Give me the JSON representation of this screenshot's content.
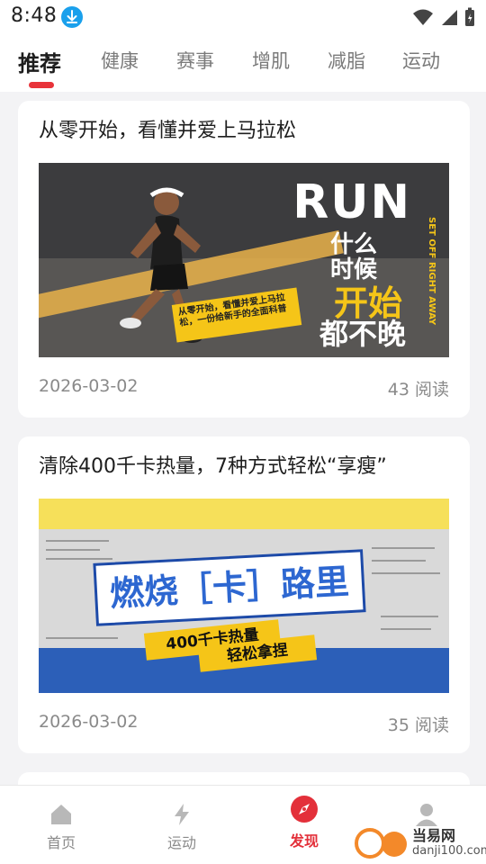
{
  "status_bar": {
    "time": "8:48"
  },
  "tabs": [
    {
      "label": "推荐",
      "active": true
    },
    {
      "label": "健康"
    },
    {
      "label": "赛事"
    },
    {
      "label": "增肌"
    },
    {
      "label": "减脂"
    },
    {
      "label": "运动"
    }
  ],
  "feed": [
    {
      "title": "从零开始，看懂并爱上马拉松",
      "date": "2026-03-02",
      "reads": "43 阅读",
      "banner": {
        "headline": "RUN",
        "line1": "什么",
        "line2": "时候",
        "line3": "开始",
        "line4a": "都",
        "line4b": "不晚",
        "side": "SET OFF RIGHT AWAY",
        "sticker": "从零开始，看懂并爱上马拉松，一份给新手的全面科普"
      }
    },
    {
      "title": "清除400千卡热量，7种方式轻松“享瘦”",
      "date": "2026-03-02",
      "reads": "35 阅读",
      "banner": {
        "headline": "燃烧［卡］路里",
        "tag1": "400千卡热量",
        "tag2": "轻松拿捏"
      }
    }
  ],
  "bottom_nav": [
    {
      "label": "首页",
      "icon": "home-icon"
    },
    {
      "label": "运动",
      "icon": "lightning-icon"
    },
    {
      "label": "发现",
      "icon": "compass-icon",
      "active": true
    },
    {
      "label": "",
      "icon": "profile-icon"
    }
  ],
  "watermark": {
    "name": "当易网",
    "url": "danji100.com"
  },
  "colors": {
    "accent": "#e8333a",
    "background": "#f3f3f5",
    "banner_yellow": "#f5c518"
  }
}
